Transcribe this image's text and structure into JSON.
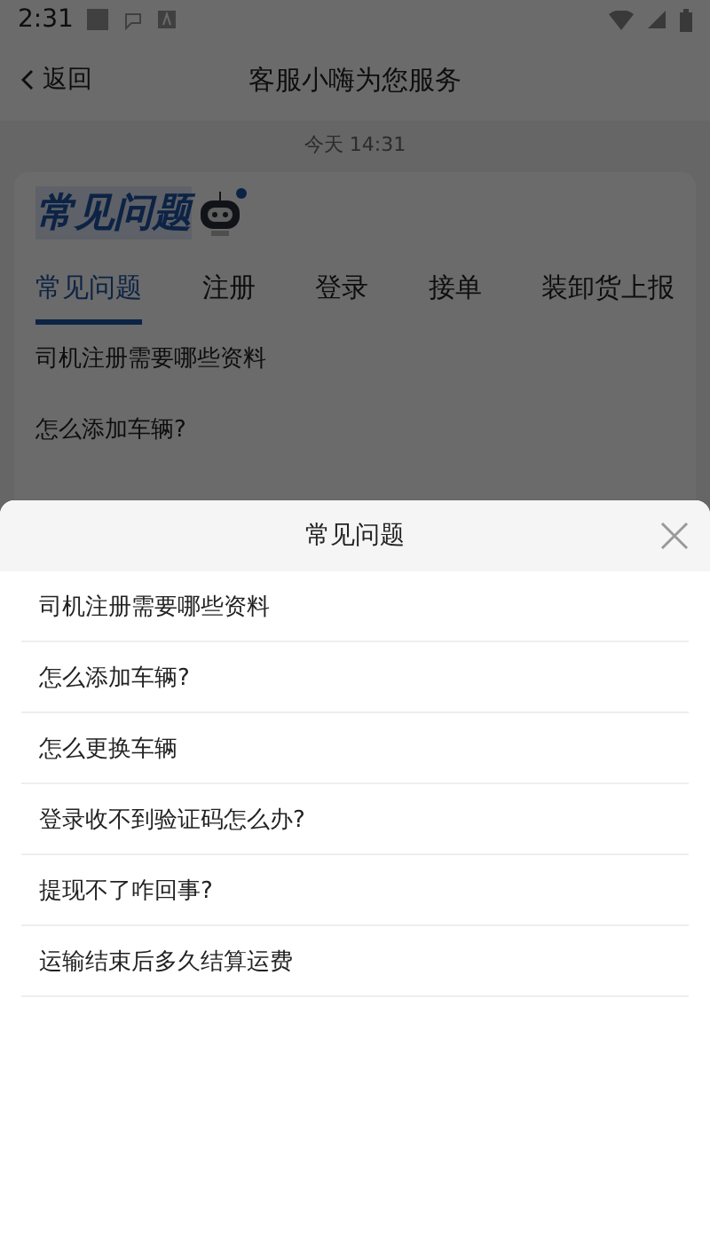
{
  "status_bar": {
    "time": "2:31"
  },
  "nav": {
    "back": "返回",
    "title": "客服小嗨为您服务"
  },
  "timestamp": "今天  14:31",
  "card": {
    "logo_text": "常见问题",
    "tabs": [
      {
        "label": "常见问题",
        "selected": true
      },
      {
        "label": "注册",
        "selected": false
      },
      {
        "label": "登录",
        "selected": false
      },
      {
        "label": "接单",
        "selected": false
      },
      {
        "label": "装卸货上报",
        "selected": false
      }
    ],
    "questions": [
      "司机注册需要哪些资料",
      "怎么添加车辆?"
    ]
  },
  "sheet": {
    "title": "常见问题",
    "items": [
      "司机注册需要哪些资料",
      "怎么添加车辆?",
      "怎么更换车辆",
      "登录收不到验证码怎么办?",
      "提现不了咋回事?",
      "运输结束后多久结算运费"
    ]
  }
}
